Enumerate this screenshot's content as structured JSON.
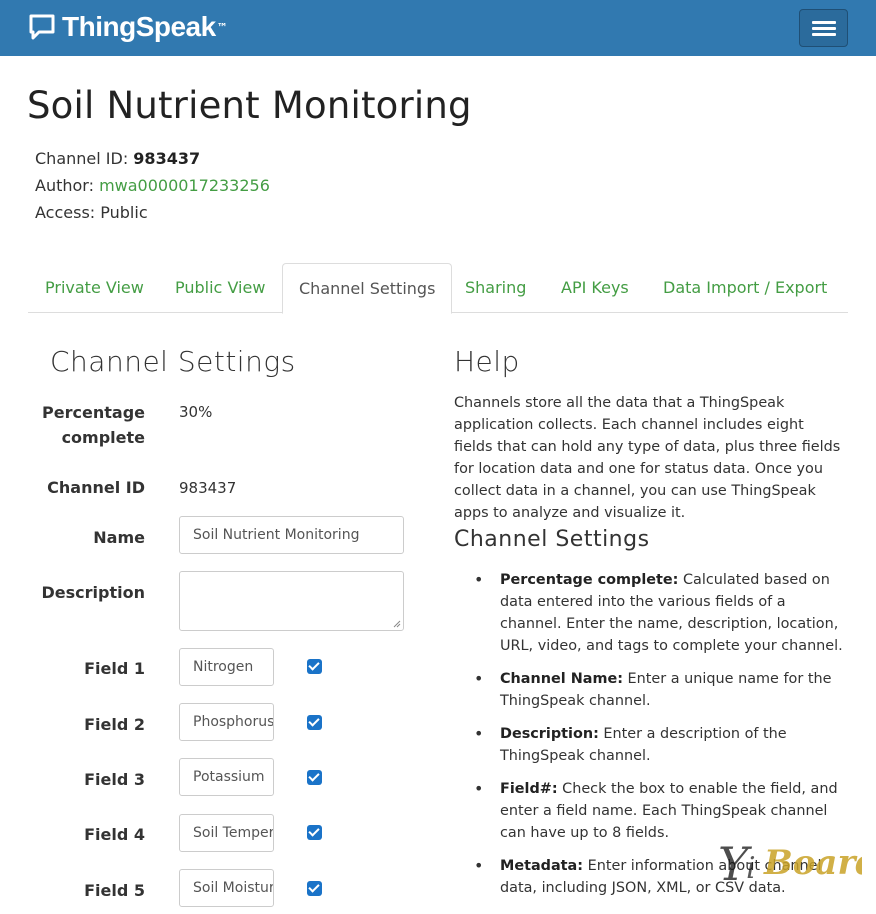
{
  "navbar": {
    "brand": "ThingSpeak",
    "brand_tm": "™"
  },
  "page": {
    "title": "Soil Nutrient Monitoring",
    "channel_id_label": "Channel ID:",
    "channel_id": "983437",
    "author_label": "Author:",
    "author": "mwa0000017233256",
    "access_label": "Access:",
    "access": "Public"
  },
  "tabs": [
    {
      "label": "Private View"
    },
    {
      "label": "Public View"
    },
    {
      "label": "Channel Settings"
    },
    {
      "label": "Sharing"
    },
    {
      "label": "API Keys"
    },
    {
      "label": "Data Import / Export"
    }
  ],
  "settings": {
    "title": "Channel Settings",
    "percentage_label_1": "Percentage",
    "percentage_label_2": "complete",
    "percentage_value": "30%",
    "channel_id_label": "Channel ID",
    "channel_id_value": "983437",
    "name_label": "Name",
    "name_value": "Soil Nutrient Monitoring",
    "description_label": "Description",
    "description_value": "",
    "fields": [
      {
        "label": "Field 1",
        "value": "Nitrogen",
        "checked": true
      },
      {
        "label": "Field 2",
        "value": "Phosphorus",
        "checked": true
      },
      {
        "label": "Field 3",
        "value": "Potassium",
        "checked": true
      },
      {
        "label": "Field 4",
        "value": "Soil Temperature",
        "checked": true
      },
      {
        "label": "Field 5",
        "value": "Soil Moisture",
        "checked": true
      }
    ]
  },
  "help": {
    "title": "Help",
    "intro": "Channels store all the data that a ThingSpeak application collects. Each channel includes eight fields that can hold any type of data, plus three fields for location data and one for status data. Once you collect data in a channel, you can use ThingSpeak apps to analyze and visualize it.",
    "subtitle": "Channel Settings",
    "items": [
      {
        "term": "Percentage complete:",
        "text": " Calculated based on data entered into the various fields of a channel. Enter the name, description, location, URL, video, and tags to complete your channel."
      },
      {
        "term": "Channel Name:",
        "text": " Enter a unique name for the ThingSpeak channel."
      },
      {
        "term": "Description:",
        "text": " Enter a description of the ThingSpeak channel."
      },
      {
        "term": "Field#:",
        "text": " Check the box to enable the field, and enter a field name. Each ThingSpeak channel can have up to 8 fields."
      },
      {
        "term": "Metadata:",
        "text": " Enter information about channel data, including JSON, XML, or CSV data."
      }
    ]
  },
  "watermark": {
    "text": "YiBoard"
  },
  "colors": {
    "navbar": "#3179b0",
    "link_green": "#449d44",
    "checkbox_blue": "#1a73c8"
  }
}
